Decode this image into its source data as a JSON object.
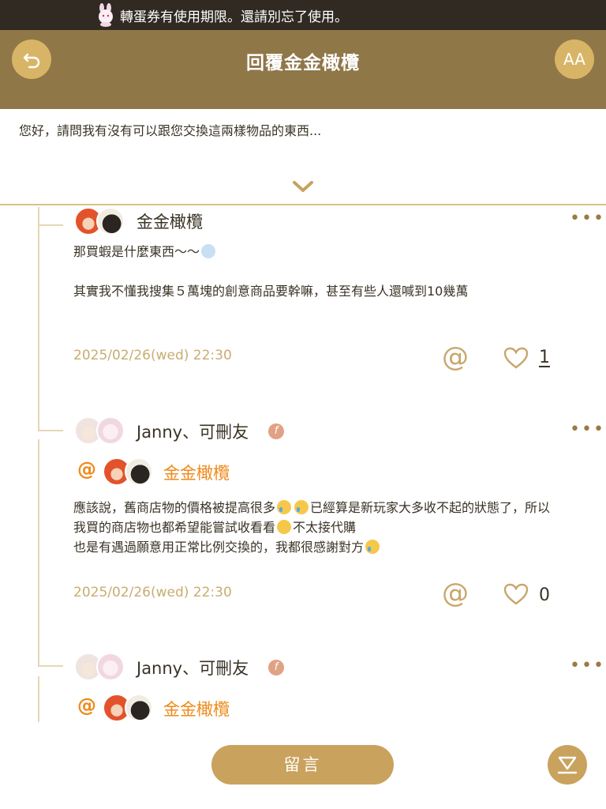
{
  "banner": {
    "text": "轉蛋券有使用期限。還請別忘了使用。"
  },
  "header": {
    "title": "回覆金金橄欖",
    "font_button_label": "AA"
  },
  "quoted_post": {
    "text": "您好，請問我有沒有可以跟您交換這兩樣物品的東西..."
  },
  "comments": [
    {
      "author": "金金橄欖",
      "line1": "那買蝦是什麼東西～～",
      "line2": "其實我不懂我搜集５萬塊的創意商品要幹嘛，甚至有些人還喊到10幾萬",
      "timestamp": "2025/02/26(wed) 22:30",
      "likes": "1"
    },
    {
      "author": "Janny、可刪友",
      "badge": "f",
      "mention": "金金橄欖",
      "line1_a": "應該說，舊商店物的價格被提高很多",
      "line1_b": "已經算是新玩家大多收不起的狀態了，所以",
      "line2_a": "我買的商店物也都希望能嘗試收看看",
      "line2_b": "不太接代購",
      "line3": "也是有遇過願意用正常比例交換的，我都很感謝對方",
      "timestamp": "2025/02/26(wed) 22:30",
      "likes": "0"
    },
    {
      "author": "Janny、可刪友",
      "badge": "f",
      "mention": "金金橄欖"
    }
  ],
  "footer": {
    "comment_button": "留言"
  },
  "colors": {
    "header_bg": "#8f7748",
    "accent_gold": "#c9a25e",
    "mention_orange": "#ee8a1a"
  },
  "icons": [
    "back-icon",
    "font-size-icon",
    "chevron-down-icon",
    "at-icon",
    "heart-icon",
    "more-icon",
    "scroll-bottom-icon"
  ]
}
